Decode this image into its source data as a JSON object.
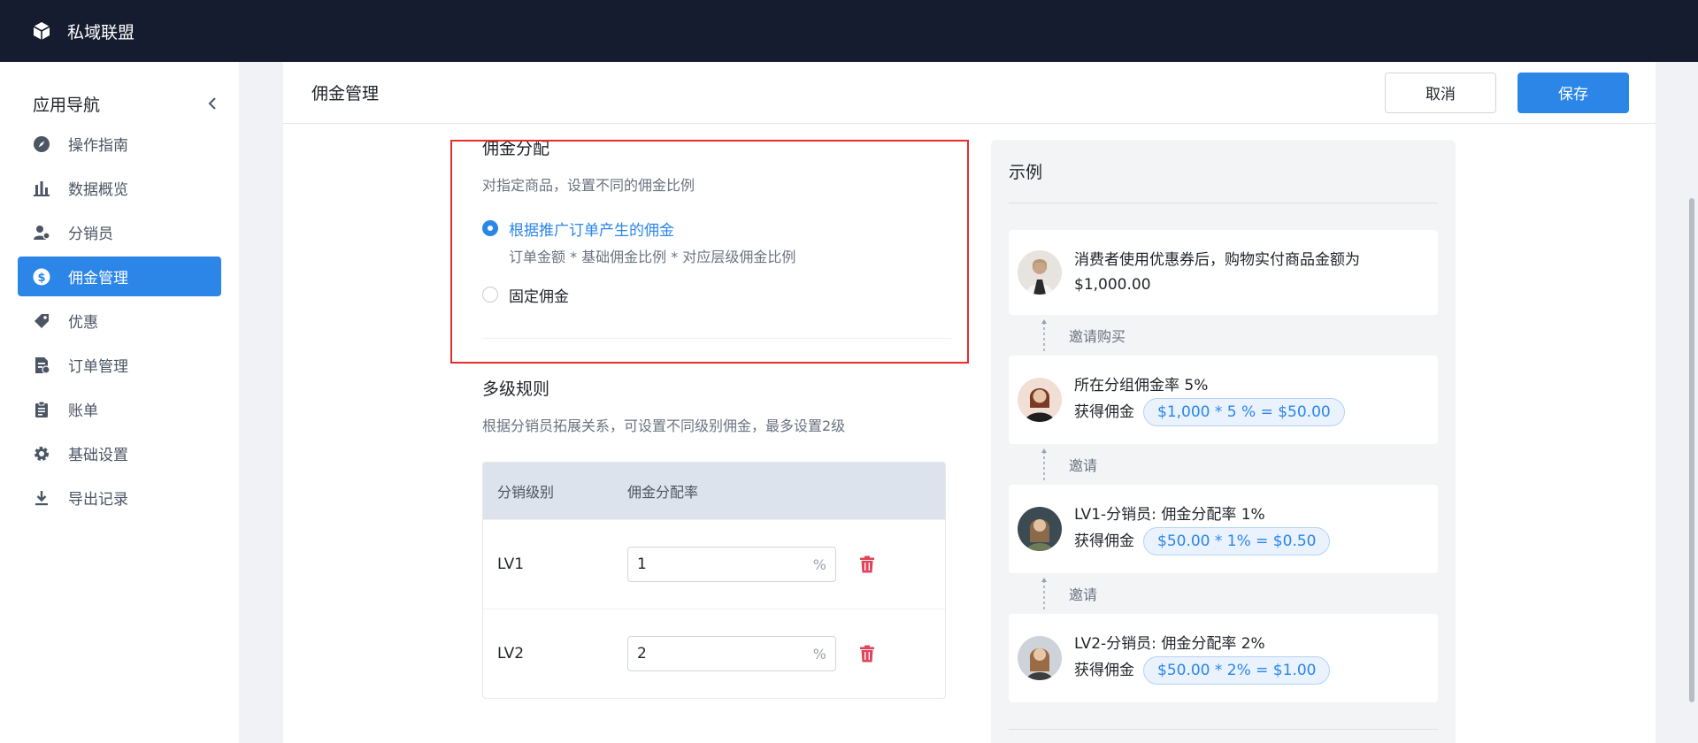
{
  "app": {
    "title": "私域联盟",
    "logo_icon": "cube-icon"
  },
  "sidebar": {
    "title": "应用导航",
    "items": [
      {
        "label": "操作指南",
        "icon": "compass-icon",
        "active": false
      },
      {
        "label": "数据概览",
        "icon": "bar-chart-icon",
        "active": false
      },
      {
        "label": "分销员",
        "icon": "users-coins-icon",
        "active": false
      },
      {
        "label": "佣金管理",
        "icon": "dollar-circle-icon",
        "active": true
      },
      {
        "label": "优惠",
        "icon": "tag-icon",
        "active": false
      },
      {
        "label": "订单管理",
        "icon": "order-icon",
        "active": false
      },
      {
        "label": "账单",
        "icon": "clipboard-icon",
        "active": false
      },
      {
        "label": "基础设置",
        "icon": "gear-icon",
        "active": false
      },
      {
        "label": "导出记录",
        "icon": "download-icon",
        "active": false
      }
    ]
  },
  "header": {
    "title": "佣金管理",
    "cancel_label": "取消",
    "save_label": "保存"
  },
  "commission": {
    "title": "佣金分配",
    "desc": "对指定商品，设置不同的佣金比例",
    "options": [
      {
        "label": "根据推广订单产生的佣金",
        "sub": "订单金额 * 基础佣金比例 * 对应层级佣金比例",
        "checked": true
      },
      {
        "label": "固定佣金",
        "sub": "",
        "checked": false
      }
    ]
  },
  "rules": {
    "title": "多级规则",
    "desc": "根据分销员拓展关系，可设置不同级别佣金，最多设置2级",
    "headers": {
      "level": "分销级别",
      "rate": "佣金分配率"
    },
    "rows": [
      {
        "level": "LV1",
        "value": "1",
        "unit": "%"
      },
      {
        "level": "LV2",
        "value": "2",
        "unit": "%"
      }
    ]
  },
  "example": {
    "title": "示例",
    "consumer": {
      "line1": "消费者使用优惠券后，购物实付商品金额为",
      "line2": "$1,000.00"
    },
    "connector1": "邀请购买",
    "group": {
      "line1": "所在分组佣金率 5%",
      "earn_label": "获得佣金",
      "formula": "$1,000 * 5 % = $50.00"
    },
    "connector2": "邀请",
    "lv1": {
      "line1": "LV1-分销员: 佣金分配率 1%",
      "earn_label": "获得佣金",
      "formula": "$50.00 * 1% = $0.50"
    },
    "connector3": "邀请",
    "lv2": {
      "line1": "LV2-分销员: 佣金分配率 2%",
      "earn_label": "获得佣金",
      "formula": "$50.00 * 2% = $1.00"
    }
  },
  "colors": {
    "accent": "#2b86e8",
    "topbar": "#151c30",
    "highlight": "#e52d2d",
    "delete": "#e0445a"
  }
}
